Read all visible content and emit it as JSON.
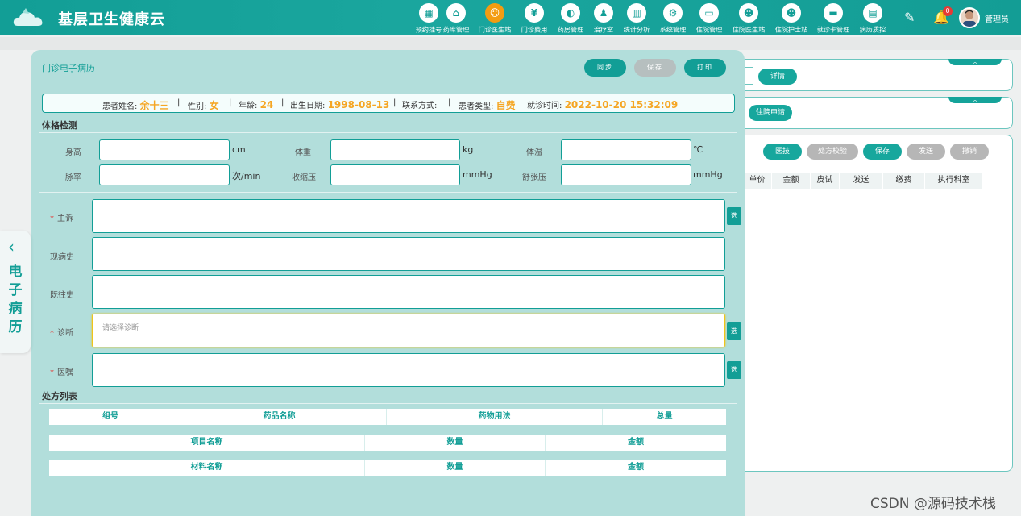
{
  "header": {
    "title": "基层卫生健康云",
    "nav": [
      {
        "label": "预约挂号",
        "icon": "calendar-icon",
        "glyph": "▦"
      },
      {
        "label": "药库管理",
        "icon": "house-icon",
        "glyph": "⌂"
      },
      {
        "label": "门诊医生站",
        "icon": "doctor-icon",
        "glyph": "☺"
      },
      {
        "label": "门诊费用",
        "icon": "yen-icon",
        "glyph": "¥"
      },
      {
        "label": "药房管理",
        "icon": "pill-icon",
        "glyph": "◐"
      },
      {
        "label": "治疗室",
        "icon": "person-icon",
        "glyph": "♟"
      },
      {
        "label": "统计分析",
        "icon": "chart-icon",
        "glyph": "▥"
      },
      {
        "label": "系统管理",
        "icon": "gear-icon",
        "glyph": "⚙"
      },
      {
        "label": "住院管理",
        "icon": "bed-icon",
        "glyph": "▭"
      },
      {
        "label": "住院医生站",
        "icon": "doctor-card-icon",
        "glyph": "☻"
      },
      {
        "label": "住院护士站",
        "icon": "nurse-card-icon",
        "glyph": "☻"
      },
      {
        "label": "就诊卡管理",
        "icon": "card-icon",
        "glyph": "▬"
      },
      {
        "label": "病历质控",
        "icon": "document-icon",
        "glyph": "▤"
      }
    ],
    "notifications": "0",
    "user": "管理员"
  },
  "side_tab": {
    "label": "电子病历"
  },
  "right_panel": {
    "detail_btn": "详情",
    "admission_btn": "住院申请",
    "actions": [
      "医技",
      "处方校验",
      "保存",
      "发送",
      "撤销"
    ],
    "columns": [
      "单价",
      "金额",
      "皮试",
      "发送",
      "缴费",
      "执行科室"
    ]
  },
  "modal": {
    "title": "门诊电子病历",
    "buttons": {
      "sync": "同步",
      "save": "保存",
      "print": "打印"
    },
    "patient": {
      "name_label": "患者姓名:",
      "name": "余十三",
      "gender_label": "性别:",
      "gender": "女",
      "age_label": "年龄:",
      "age": "24",
      "dob_label": "出生日期:",
      "dob": "1998-08-13",
      "contact_label": "联系方式:",
      "contact": "",
      "type_label": "患者类型:",
      "type": "自费",
      "visit_label": "就诊时间:",
      "visit_time": "2022-10-20 15:32:09"
    },
    "vitals_title": "体格检测",
    "vitals": {
      "height_label": "身高",
      "height_unit": "cm",
      "weight_label": "体重",
      "weight_unit": "kg",
      "temp_label": "体温",
      "temp_unit": "℃",
      "pulse_label": "脉率",
      "pulse_unit": "次/min",
      "sys_label": "收缩压",
      "sys_unit": "mmHg",
      "dia_label": "舒张压",
      "dia_unit": "mmHg"
    },
    "fields": {
      "chief_complaint": "主诉",
      "present_history": "现病史",
      "past_history": "既往史",
      "diagnosis": "诊断",
      "diagnosis_placeholder": "请选择诊断",
      "orders": "医嘱",
      "select_btn": "选"
    },
    "rx_title": "处方列表",
    "rx_table": [
      "组号",
      "药品名称",
      "药物用法",
      "总量"
    ],
    "item_table": [
      "项目名称",
      "数量",
      "金额"
    ],
    "material_table": [
      "材料名称",
      "数量",
      "金额"
    ]
  },
  "watermark": "CSDN @源码技术栈"
}
